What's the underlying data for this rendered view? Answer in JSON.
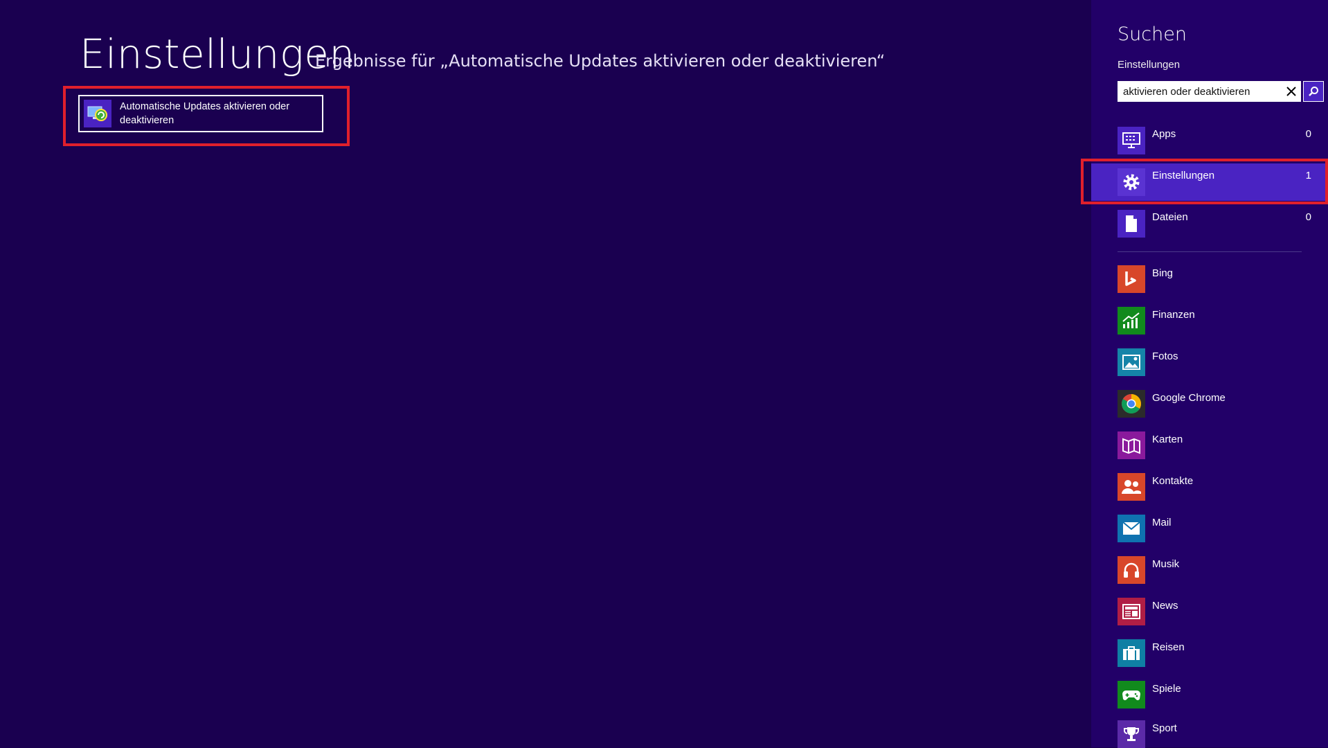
{
  "main": {
    "title": "Einstellungen",
    "results_label": "Ergebnisse für „Automatische Updates aktivieren oder deaktivieren“",
    "results": [
      {
        "label": "Automatische Updates aktivieren oder deaktivieren",
        "icon": "windows-update-icon"
      }
    ]
  },
  "search_pane": {
    "title": "Suchen",
    "scope": "Einstellungen",
    "query": "aktivieren oder deaktivieren",
    "clear_icon": "close-icon",
    "search_icon": "search-icon",
    "categories": [
      {
        "label": "Apps",
        "count": "0",
        "icon": "apps-icon",
        "selected": false
      },
      {
        "label": "Einstellungen",
        "count": "1",
        "icon": "gear-icon",
        "selected": true
      },
      {
        "label": "Dateien",
        "count": "0",
        "icon": "file-icon",
        "selected": false
      }
    ],
    "apps": [
      {
        "label": "Bing",
        "icon": "bing-icon",
        "color": "#d8472a"
      },
      {
        "label": "Finanzen",
        "icon": "finance-icon",
        "color": "#118a1d"
      },
      {
        "label": "Fotos",
        "icon": "photos-icon",
        "color": "#1584a8"
      },
      {
        "label": "Google Chrome",
        "icon": "chrome-icon",
        "color": "#2b2b2b"
      },
      {
        "label": "Karten",
        "icon": "maps-icon",
        "color": "#8a1a9c"
      },
      {
        "label": "Kontakte",
        "icon": "contacts-icon",
        "color": "#d8472a"
      },
      {
        "label": "Mail",
        "icon": "mail-icon",
        "color": "#0f72b0"
      },
      {
        "label": "Musik",
        "icon": "music-icon",
        "color": "#d8472a"
      },
      {
        "label": "News",
        "icon": "news-icon",
        "color": "#b01e45"
      },
      {
        "label": "Reisen",
        "icon": "travel-icon",
        "color": "#0f7fa4"
      },
      {
        "label": "Spiele",
        "icon": "games-icon",
        "color": "#118a1d"
      },
      {
        "label": "Sport",
        "icon": "sport-icon",
        "color": "#5b2aa8"
      }
    ]
  },
  "colors": {
    "background": "#1a0050",
    "pane_background": "#220068",
    "accent": "#4a23c2",
    "highlight_border": "#e0202c"
  }
}
